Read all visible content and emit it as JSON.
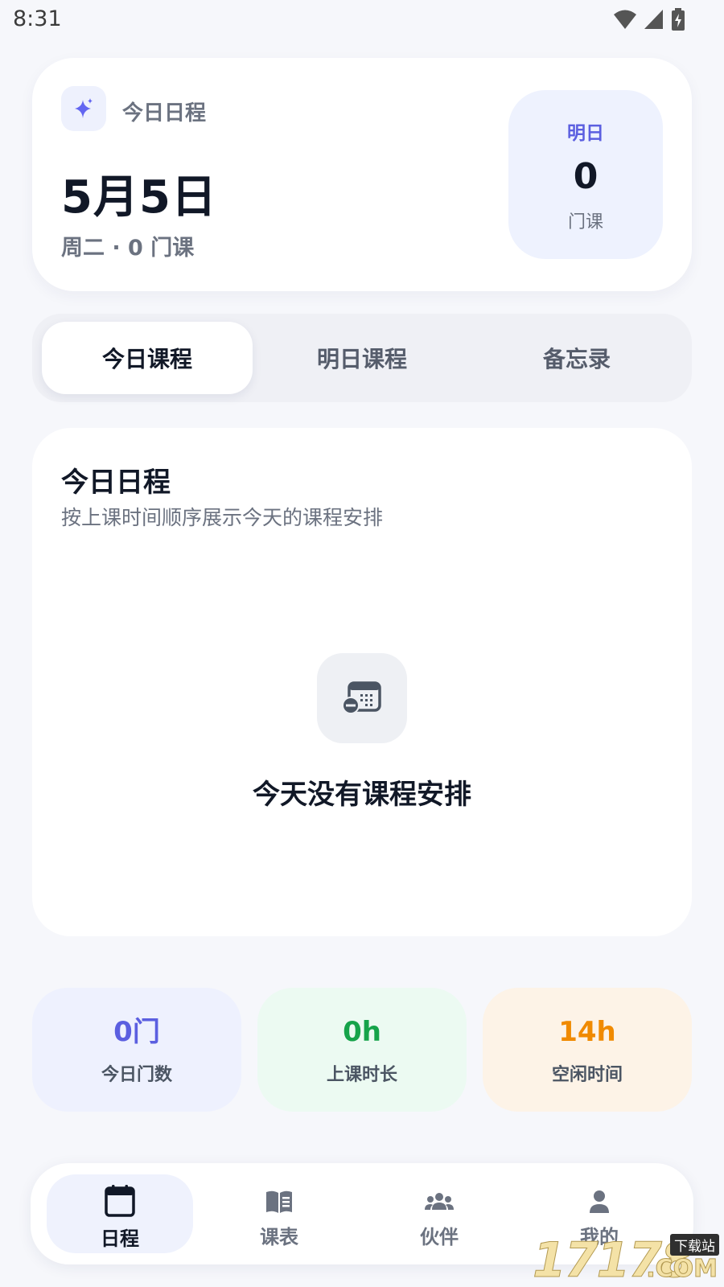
{
  "status_bar": {
    "time": "8:31",
    "icons": [
      "wifi-icon",
      "cellular-signal-icon",
      "battery-charging-icon"
    ]
  },
  "header": {
    "label": "今日日程",
    "date": "5月5日",
    "subtitle": "周二 · 0 门课",
    "tomorrow": {
      "label": "明日",
      "count": "0",
      "unit": "门课"
    },
    "icon": "sparkle-icon",
    "accent_color": "#5b5fe0"
  },
  "tabs": [
    {
      "label": "今日课程",
      "active": true
    },
    {
      "label": "明日课程",
      "active": false
    },
    {
      "label": "备忘录",
      "active": false
    }
  ],
  "schedule": {
    "title": "今日日程",
    "description": "按上课时间顺序展示今天的课程安排",
    "empty_icon": "calendar-remove-icon",
    "empty_text": "今天没有课程安排"
  },
  "stats": [
    {
      "value": "0门",
      "label": "今日门数",
      "color": "#5b5fe0"
    },
    {
      "value": "0h",
      "label": "上课时长",
      "color": "#16a34a"
    },
    {
      "value": "14h",
      "label": "空闲时间",
      "color": "#f08a00"
    }
  ],
  "nav": [
    {
      "label": "日程",
      "icon": "calendar-icon",
      "active": true
    },
    {
      "label": "课表",
      "icon": "book-icon",
      "active": false
    },
    {
      "label": "伙伴",
      "icon": "group-icon",
      "active": false
    },
    {
      "label": "我的",
      "icon": "person-icon",
      "active": false
    }
  ],
  "watermark": {
    "number": "17178",
    "tag": "下载站",
    "suffix": ".COM"
  }
}
